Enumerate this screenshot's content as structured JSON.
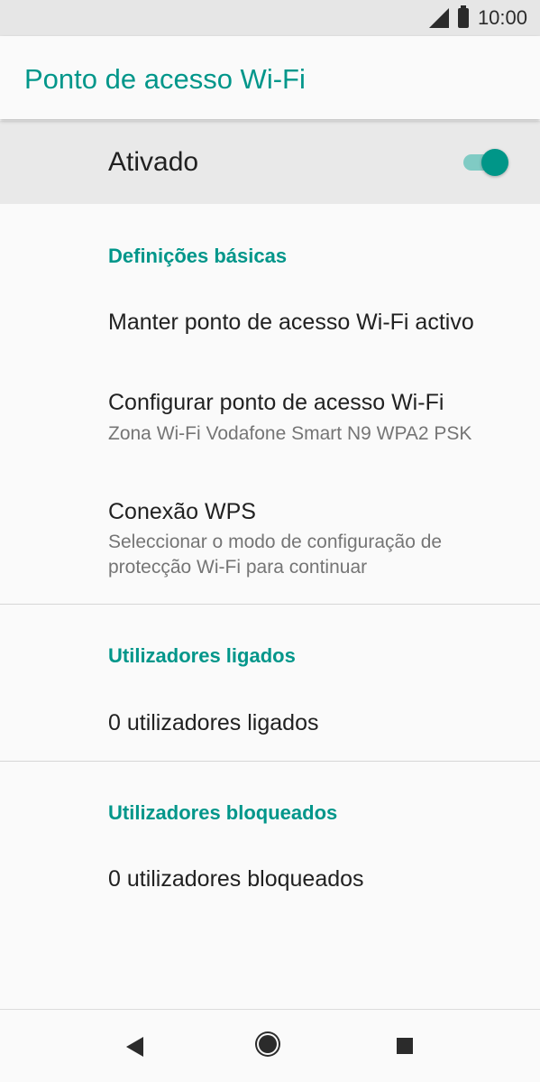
{
  "status_bar": {
    "time": "10:00",
    "icons": [
      "signal-icon",
      "battery-icon"
    ]
  },
  "app_bar": {
    "title": "Ponto de acesso Wi-Fi"
  },
  "master_toggle": {
    "label": "Ativado",
    "state": "on"
  },
  "sections": {
    "basic": {
      "header": "Definições básicas",
      "items": [
        {
          "title": "Manter ponto de acesso Wi-Fi activo"
        },
        {
          "title": "Configurar ponto de acesso Wi-Fi",
          "summary": "Zona Wi-Fi Vodafone Smart N9 WPA2 PSK"
        },
        {
          "title": "Conexão WPS",
          "summary": "Seleccionar o modo de configuração de protecção Wi-Fi para continuar"
        }
      ]
    },
    "connected": {
      "header": "Utilizadores ligados",
      "items": [
        {
          "title": "0 utilizadores ligados"
        }
      ]
    },
    "blocked": {
      "header": "Utilizadores bloqueados",
      "items": [
        {
          "title": "0 utilizadores bloqueados"
        }
      ]
    }
  },
  "nav_bar": {
    "buttons": [
      "back-icon",
      "home-icon",
      "recents-icon"
    ]
  },
  "colors": {
    "accent": "#00968a",
    "switch_thumb": "#009688",
    "switch_track": "#80cbc4",
    "status_bar_bg": "#e6e6e6",
    "toggle_row_bg": "#e9e9e9",
    "background": "#fafafa"
  }
}
